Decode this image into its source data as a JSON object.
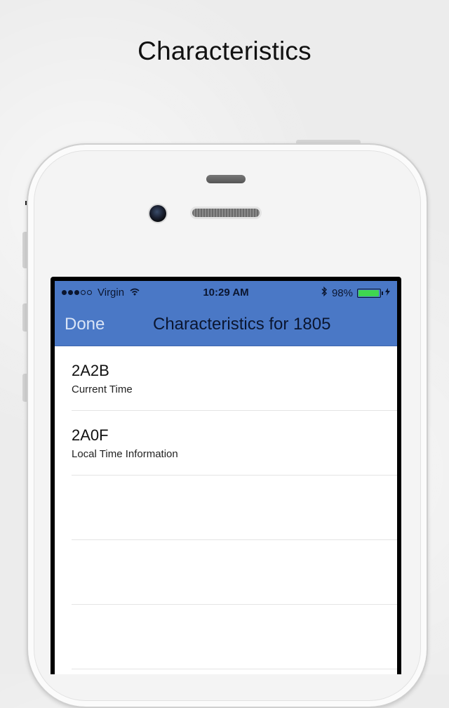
{
  "headline": "Characteristics",
  "status_bar": {
    "carrier": "Virgin",
    "time": "10:29 AM",
    "battery_text": "98%",
    "battery_level": 0.98,
    "signal_bars_filled": 3,
    "signal_bars_total": 5,
    "icons": [
      "wifi-icon",
      "bluetooth-icon",
      "battery-icon",
      "charging-icon"
    ]
  },
  "nav": {
    "done_label": "Done",
    "title": "Characteristics for 1805"
  },
  "list": {
    "items": [
      {
        "uuid": "2A2B",
        "name": "Current Time"
      },
      {
        "uuid": "2A0F",
        "name": "Local Time Information"
      }
    ]
  },
  "colors": {
    "nav_bg": "#4a78c6",
    "battery_fill": "#3fd64f"
  }
}
